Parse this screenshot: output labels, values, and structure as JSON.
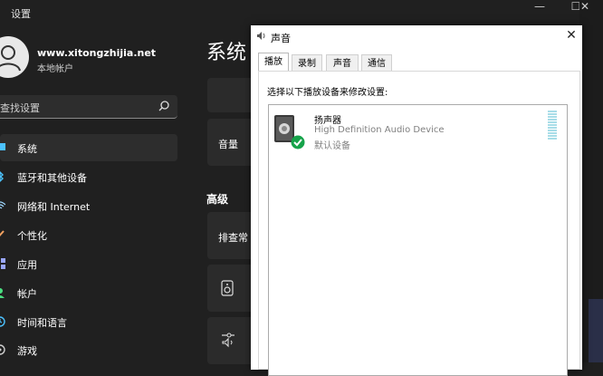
{
  "settings": {
    "window_title": "设置",
    "controls": {
      "minimize": "—",
      "maximize": "☐",
      "close": "✕"
    },
    "account": {
      "name": "www.xitongzhijia.net",
      "type": "本地帐户"
    },
    "search": {
      "placeholder": "查找设置"
    },
    "nav": [
      {
        "label": "系统",
        "icon": "system-icon",
        "active": true
      },
      {
        "label": "蓝牙和其他设备",
        "icon": "bluetooth-icon"
      },
      {
        "label": "网络和 Internet",
        "icon": "network-icon"
      },
      {
        "label": "个性化",
        "icon": "personalization-icon"
      },
      {
        "label": "应用",
        "icon": "apps-icon"
      },
      {
        "label": "帐户",
        "icon": "account-icon"
      },
      {
        "label": "时间和语言",
        "icon": "time-language-icon"
      },
      {
        "label": "游戏",
        "icon": "gaming-icon"
      }
    ],
    "page_title": "系统",
    "volume_label": "音量",
    "advanced_title": "高级",
    "advanced_row_label": "排查常"
  },
  "dialog": {
    "title": "声音",
    "close": "✕",
    "tabs": [
      "播放",
      "录制",
      "声音",
      "通信"
    ],
    "active_tab": "播放",
    "instruction": "选择以下播放设备来修改设置:",
    "device": {
      "name": "扬声器",
      "description": "High Definition Audio Device",
      "status": "默认设备"
    }
  },
  "colors": {
    "accent_green": "#16a34a",
    "meter": "#a8dde8",
    "settings_bg": "#202020"
  }
}
